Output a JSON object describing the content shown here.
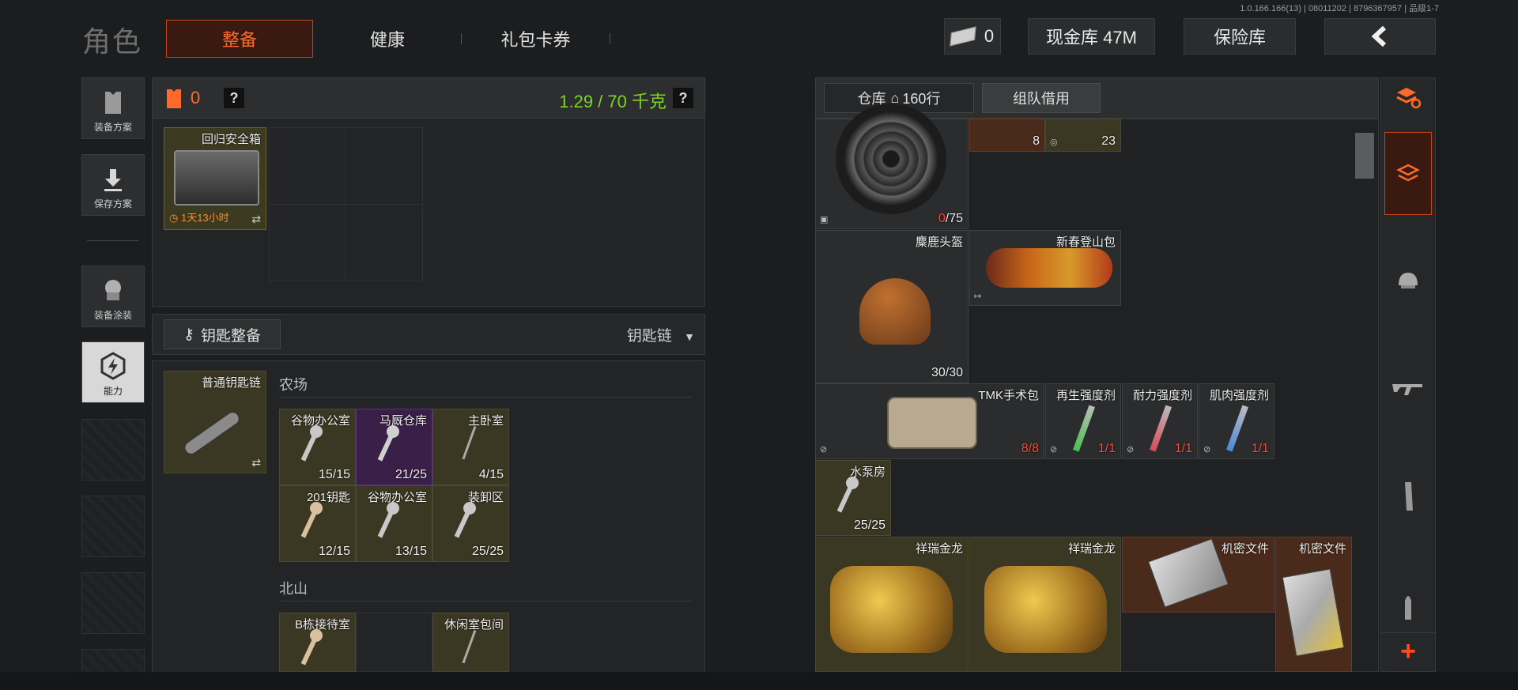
{
  "version": "1.0.166.166(13) | 08011202 | 8796367957 | 品级1-7",
  "header": {
    "title": "角色",
    "tabs": [
      {
        "label": "整备",
        "active": true
      },
      {
        "label": "健康"
      },
      {
        "label": "礼包卡券"
      }
    ],
    "currency_value": "0",
    "cash_vault": "现金库 47M",
    "safe_vault": "保险库"
  },
  "sidebar": {
    "items": [
      {
        "label": "装备方案"
      },
      {
        "label": "保存方案"
      },
      {
        "label": "装备涂装"
      },
      {
        "label": "能力"
      }
    ]
  },
  "loadout": {
    "armor_count": "0",
    "weight": "1.29 / 70 千克",
    "help": "?",
    "case": {
      "name": "回归安全箱",
      "timer": "1天13小时"
    }
  },
  "keys": {
    "tab_label": "钥匙整备",
    "dropdown_label": "钥匙链",
    "keychain_name": "普通钥匙链",
    "groups": [
      {
        "name": "农场",
        "keys": [
          {
            "name": "谷物办公室",
            "count": "15/15",
            "style": "gold"
          },
          {
            "name": "马厩仓库",
            "count": "21/25",
            "style": "purple"
          },
          {
            "name": "主卧室",
            "count": "4/15",
            "style": "gold"
          },
          {
            "name": "201钥匙",
            "count": "12/15",
            "style": "gold"
          },
          {
            "name": "谷物办公室",
            "count": "13/15",
            "style": "gold"
          },
          {
            "name": "装卸区",
            "count": "25/25",
            "style": "gold"
          }
        ]
      },
      {
        "name": "北山",
        "keys": [
          {
            "name": "B栋接待室",
            "count": "",
            "style": "gold"
          },
          {
            "name": "休闲室包间",
            "count": "",
            "style": "gold"
          }
        ]
      }
    ]
  },
  "warehouse": {
    "tab_label": "仓库",
    "rows_label": "160行",
    "team_borrow": "组队借用",
    "items": [
      {
        "id": "drum",
        "name": "",
        "count_red": "0",
        "count": "/75"
      },
      {
        "id": "top1",
        "name": "",
        "count": "8"
      },
      {
        "id": "top2",
        "name": "",
        "count": "23"
      },
      {
        "id": "helmet",
        "name": "麋鹿头盔",
        "count": "30/30"
      },
      {
        "id": "bag",
        "name": "新春登山包",
        "count": ""
      },
      {
        "id": "tmk",
        "name": "TMK手术包",
        "count": "8/8"
      },
      {
        "id": "regen",
        "name": "再生强度剂",
        "count": "1/1"
      },
      {
        "id": "endur",
        "name": "耐力强度剂",
        "count": "1/1"
      },
      {
        "id": "muscle",
        "name": "肌肉强度剂",
        "count": "1/1"
      },
      {
        "id": "pump",
        "name": "水泵房",
        "count": "25/25"
      },
      {
        "id": "dragon1",
        "name": "祥瑞金龙",
        "count": ""
      },
      {
        "id": "dragon2",
        "name": "祥瑞金龙",
        "count": ""
      },
      {
        "id": "secret1",
        "name": "机密文件",
        "count": ""
      },
      {
        "id": "secret2",
        "name": "机密文件",
        "count": ""
      }
    ]
  },
  "colors": {
    "accent": "#ff6a2a",
    "weight": "#7ed321",
    "gold_cell": "#3a3722",
    "purple_cell": "#3a1f48",
    "brown_cell": "#4a2a1a"
  }
}
